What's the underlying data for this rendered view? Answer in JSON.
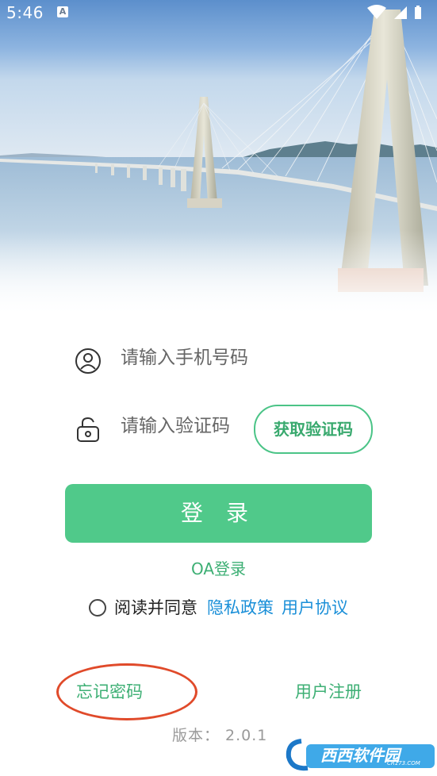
{
  "status_bar": {
    "time": "5:46",
    "notification_icon": "A"
  },
  "hero": {
    "image": "cable-stayed-bridge-photo"
  },
  "form": {
    "phone_placeholder": "请输入手机号码",
    "code_placeholder": "请输入验证码",
    "get_code_label": "获取验证码",
    "login_label": "登 录",
    "oa_login_label": "OA登录",
    "agree_text": "阅读并同意",
    "privacy_link": "隐私政策",
    "user_agreement_link": "用户协议"
  },
  "footer": {
    "forgot_password": "忘记密码",
    "register": "用户注册",
    "version": "版本： 2.0.1"
  },
  "watermark": {
    "logo_text": "西西软件园",
    "logo_subtext": "CR173.COM"
  },
  "colors": {
    "primary_green": "#50c98a",
    "link_blue": "#1a8fd8",
    "annotation_red": "#e04a2a"
  },
  "icons": {
    "user": "user-icon",
    "lock": "lock-icon",
    "radio": "radio-icon"
  }
}
